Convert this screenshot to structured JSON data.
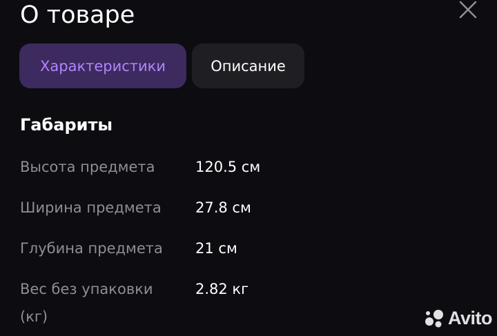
{
  "header": {
    "title": "О товаре",
    "close_icon": "close-icon"
  },
  "tabs": [
    {
      "label": "Характеристики",
      "active": true
    },
    {
      "label": "Описание",
      "active": false
    }
  ],
  "section": {
    "title": "Габариты",
    "rows": [
      {
        "label": "Высота предмета",
        "value": "120.5 см"
      },
      {
        "label": "Ширина предмета",
        "value": "27.8 см"
      },
      {
        "label": "Глубина предмета",
        "value": "21 см"
      },
      {
        "label": "Вес без упаковки\n(кг)",
        "value": "2.82 кг"
      }
    ]
  },
  "watermark": {
    "text": "Avito"
  },
  "colors": {
    "background": "#0d0c11",
    "accent": "#b185ff",
    "active_tab_bg": "#3d2a5e",
    "inactive_tab_bg": "#1f1e23",
    "muted_text": "#8f8d96"
  }
}
